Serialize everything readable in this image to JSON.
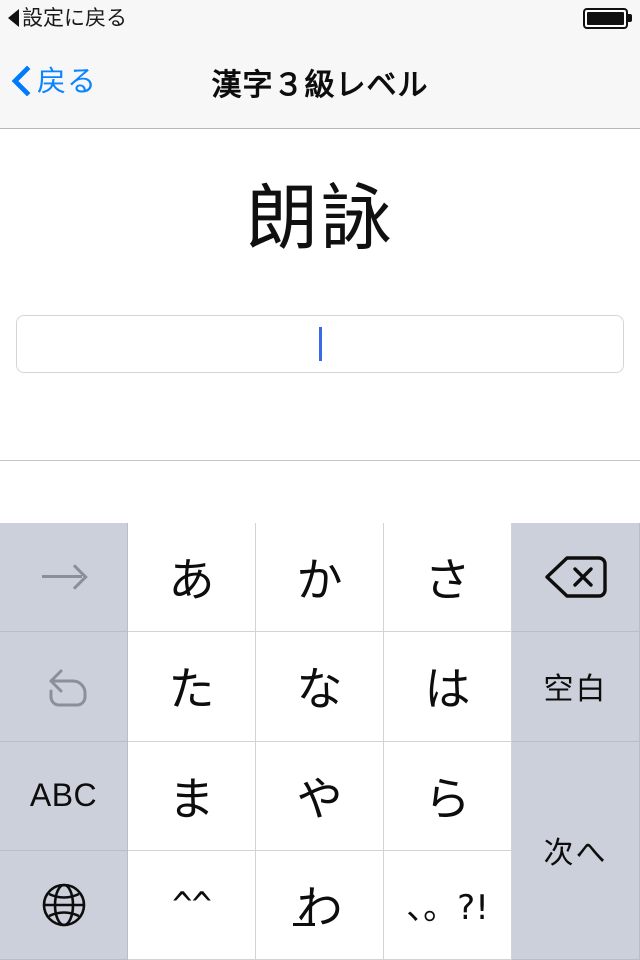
{
  "status_bar": {
    "back_label": "設定に戻る",
    "back_icon": "triangle-left-icon",
    "battery_icon": "battery-full-icon"
  },
  "nav_bar": {
    "back_label": "戻る",
    "back_icon": "chevron-left-icon",
    "title": "漢字３級レベル",
    "accent_color": "#0a84ff"
  },
  "content": {
    "question_word": "朗詠",
    "answer_value": "",
    "answer_placeholder": "",
    "caret_color": "#3a6ae4"
  },
  "candidate_bar": {
    "candidates": []
  },
  "keyboard": {
    "background_color": "#ccd0da",
    "key_color": "#ffffff",
    "rows": [
      [
        {
          "name": "cursor-right-key",
          "label": "→",
          "type": "fn",
          "icon": "arrow-right-icon",
          "disabled": true
        },
        {
          "name": "key-a",
          "label": "あ",
          "type": "char",
          "icon": ""
        },
        {
          "name": "key-ka",
          "label": "か",
          "type": "char",
          "icon": ""
        },
        {
          "name": "key-sa",
          "label": "さ",
          "type": "char",
          "icon": ""
        },
        {
          "name": "delete-key",
          "label": "",
          "type": "fn",
          "icon": "delete-backward-icon"
        }
      ],
      [
        {
          "name": "undo-key",
          "label": "↺",
          "type": "fn",
          "icon": "undo-icon",
          "disabled": true
        },
        {
          "name": "key-ta",
          "label": "た",
          "type": "char",
          "icon": ""
        },
        {
          "name": "key-na",
          "label": "な",
          "type": "char",
          "icon": ""
        },
        {
          "name": "key-ha",
          "label": "は",
          "type": "char",
          "icon": ""
        },
        {
          "name": "space-key",
          "label": "空白",
          "type": "fn",
          "icon": ""
        }
      ],
      [
        {
          "name": "abc-mode-key",
          "label": "ABC",
          "type": "fn",
          "icon": ""
        },
        {
          "name": "key-ma",
          "label": "ま",
          "type": "char",
          "icon": ""
        },
        {
          "name": "key-ya",
          "label": "や",
          "type": "char",
          "icon": ""
        },
        {
          "name": "key-ra",
          "label": "ら",
          "type": "char",
          "icon": ""
        },
        {
          "name": "next-key",
          "label": "次へ",
          "type": "fn",
          "icon": "",
          "tall": true
        }
      ],
      [
        {
          "name": "globe-key",
          "label": "",
          "type": "fn",
          "icon": "globe-icon"
        },
        {
          "name": "key-emoticon",
          "label": "^^",
          "type": "char",
          "icon": ""
        },
        {
          "name": "key-wa",
          "label": "わ",
          "type": "char",
          "icon": ""
        },
        {
          "name": "key-punctuation",
          "label": "、。?!",
          "type": "char",
          "icon": ""
        }
      ]
    ]
  }
}
